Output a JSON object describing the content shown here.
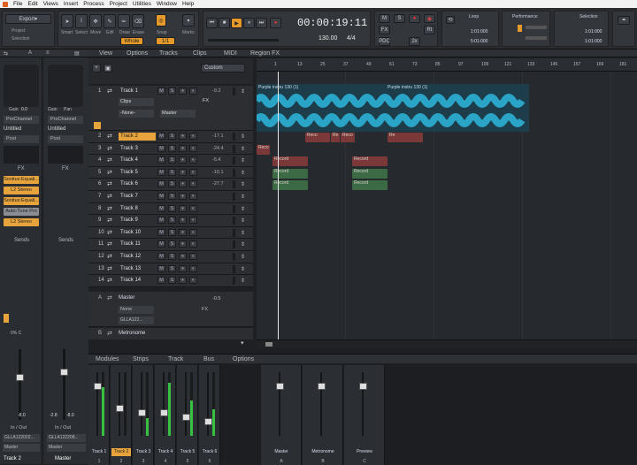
{
  "menu": {
    "items": [
      "File",
      "Edit",
      "Views",
      "Insert",
      "Process",
      "Project",
      "Utilities",
      "Window",
      "Help"
    ]
  },
  "toolbar": {
    "export": "Export",
    "project": "Project",
    "selection": "Selection",
    "tools": [
      "Smart",
      "Select",
      "Move",
      "Edit",
      "Draw",
      "Erase"
    ],
    "snap": "Snap",
    "snap_value": "1/1",
    "marks": "Marks",
    "whole": "Whole"
  },
  "transport": {
    "time": "00:00:19:11",
    "tempo": "130.00",
    "meter": "4/4",
    "fx": "FX",
    "pdc": "PDC",
    "ri": "RI",
    "twox": "2x"
  },
  "loop": {
    "title": "Loop",
    "start": "1:01:000",
    "end": "5:01:000"
  },
  "performance": {
    "title": "Performance"
  },
  "selection": {
    "title": "Selection",
    "start": "1:01:000",
    "end": "1:01:000"
  },
  "track_view": {
    "menus": [
      "View",
      "Options",
      "Tracks",
      "Clips",
      "MIDI",
      "Region FX"
    ],
    "custom": "Custom",
    "ruler": [
      "1",
      "13",
      "25",
      "37",
      "49",
      "61",
      "73",
      "85",
      "97",
      "109",
      "121",
      "133",
      "145",
      "157",
      "169",
      "181"
    ]
  },
  "tracks": [
    {
      "num": "1",
      "name": "Track 1",
      "vol": "-9.2"
    },
    {
      "num": "2",
      "name": "Track 2",
      "vol": "-17.1"
    },
    {
      "num": "3",
      "name": "Track 3",
      "vol": "-24.4"
    },
    {
      "num": "4",
      "name": "Track 4",
      "vol": "-5.4"
    },
    {
      "num": "5",
      "name": "Track 5",
      "vol": "-10.1"
    },
    {
      "num": "6",
      "name": "Track 6",
      "vol": "-27.7"
    },
    {
      "num": "7",
      "name": "Track 7",
      "vol": ""
    },
    {
      "num": "8",
      "name": "Track 8",
      "vol": ""
    },
    {
      "num": "9",
      "name": "Track 9",
      "vol": ""
    },
    {
      "num": "10",
      "name": "Track 10",
      "vol": ""
    },
    {
      "num": "11",
      "name": "Track 11",
      "vol": ""
    },
    {
      "num": "12",
      "name": "Track 12",
      "vol": ""
    },
    {
      "num": "13",
      "name": "Track 13",
      "vol": ""
    },
    {
      "num": "14",
      "name": "Track 14",
      "vol": ""
    }
  ],
  "track1_detail": {
    "clips": "Clips",
    "none": "-None-",
    "master": "Master",
    "fx": "FX"
  },
  "master_track": {
    "letter": "A",
    "name": "Master",
    "vol": "-0.5",
    "none": "None",
    "gl": "GLLA122...",
    "fx": "FX"
  },
  "metronome_track": {
    "letter": "B",
    "name": "Metronome"
  },
  "clip_labels": {
    "purple": "Purple instru 130 (1)",
    "purple2": "Purple instru 130 (1)",
    "reco": "Reco",
    "record": "Record",
    "re": "Re"
  },
  "inspector": {
    "gain": "Gain",
    "pan": "Pan",
    "gain_val": "0.0",
    "pan_val": "C",
    "prochannel": "ProChannel",
    "untitled": "Untitled",
    "post": "Post",
    "fx": "FX",
    "fx_chain": [
      "Sonitus:Equali...",
      "L2 Stereo",
      "Sonitus:Equali...",
      "Auto-Tune Pro",
      "L2 Stereo"
    ],
    "sends": "Sends",
    "inout": "In / Out",
    "in1": "GLLA122002...",
    "in2": "GLLA122208...",
    "master": "Master",
    "strip1": "Track 2",
    "strip2": "Master",
    "vol1": "-8.0",
    "vol2": "-2.8",
    "vol2b": "-8.0",
    "pan_label": "Pan",
    "pan_c": "0% C"
  },
  "console": {
    "menus": [
      "Modules",
      "Strips",
      "Track",
      "Bus",
      "Options"
    ],
    "channels": [
      {
        "name": "Track 1",
        "num": "1"
      },
      {
        "name": "Track 2",
        "num": "2"
      },
      {
        "name": "Track 3",
        "num": "3"
      },
      {
        "name": "Track 4",
        "num": "4"
      },
      {
        "name": "Track 5",
        "num": "5"
      },
      {
        "name": "Track 6",
        "num": "6"
      }
    ],
    "buses": [
      {
        "name": "Master",
        "letter": "A"
      },
      {
        "name": "Metronome",
        "letter": "B"
      },
      {
        "name": "Preview",
        "letter": "C"
      }
    ]
  },
  "colors": {
    "accent": "#e8a43c",
    "wave": "#2aa5c8",
    "clip_red": "#7a3838",
    "clip_green": "#3c6a44"
  }
}
